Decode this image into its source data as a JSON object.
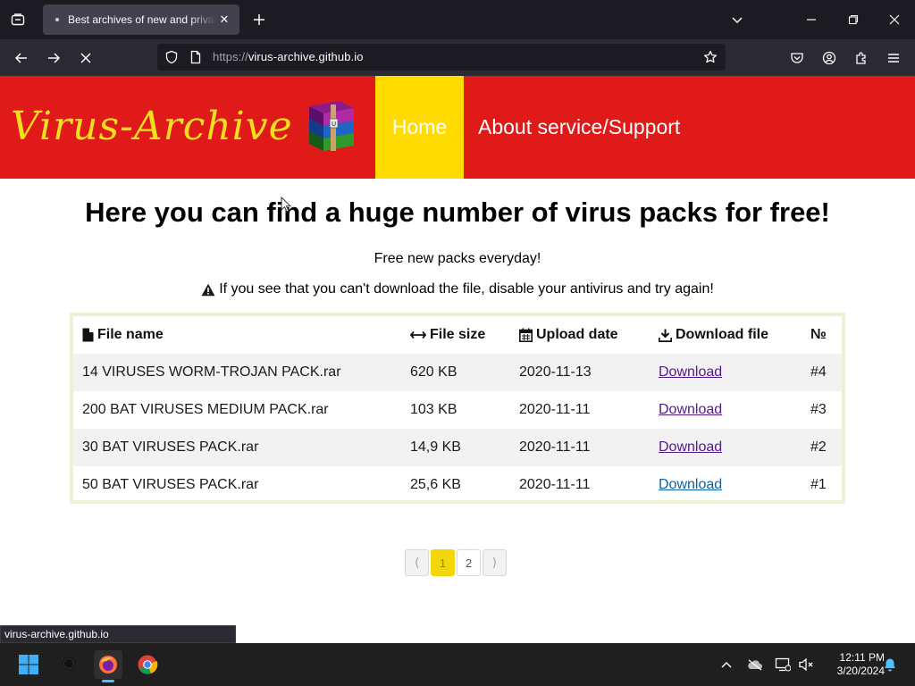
{
  "browser": {
    "tab_title": "Best archives of new and private",
    "tab_close": "✕",
    "url_proto": "https://",
    "url_host": "virus-archive.github.io",
    "status_url": "virus-archive.github.io"
  },
  "site": {
    "logo_text": "Virus-Archive",
    "nav": {
      "home": "Home",
      "about": "About service/Support"
    },
    "headline": "Here you can find a huge number of virus packs for free!",
    "subline": "Free new packs everyday!",
    "warning": "If you see that you can't download the file, disable your antivirus and try again!",
    "colors": {
      "header": "#e01919",
      "active_nav": "#ffdb00",
      "logo": "#f2e020"
    }
  },
  "table": {
    "headers": {
      "name": "File name",
      "size": "File size",
      "date": "Upload date",
      "download": "Download file",
      "num": "№"
    },
    "rows": [
      {
        "name": "14 VIRUSES WORM-TROJAN PACK.rar",
        "size": "620 KB",
        "date": "2020-11-13",
        "link": "Download",
        "num": "#4"
      },
      {
        "name": "200 BAT VIRUSES MEDIUM PACK.rar",
        "size": "103 KB",
        "date": "2020-11-11",
        "link": "Download",
        "num": "#3"
      },
      {
        "name": "30 BAT VIRUSES PACK.rar",
        "size": "14,9 KB",
        "date": "2020-11-11",
        "link": "Download",
        "num": "#2"
      },
      {
        "name": "50 BAT VIRUSES PACK.rar",
        "size": "25,6 KB",
        "date": "2020-11-11",
        "link": "Download",
        "num": "#1"
      }
    ]
  },
  "pager": {
    "prev": "⟨",
    "pages": [
      "1",
      "2"
    ],
    "next": "⟩",
    "current": "1"
  },
  "taskbar": {
    "time": "12:11 PM",
    "date": "3/20/2024"
  }
}
